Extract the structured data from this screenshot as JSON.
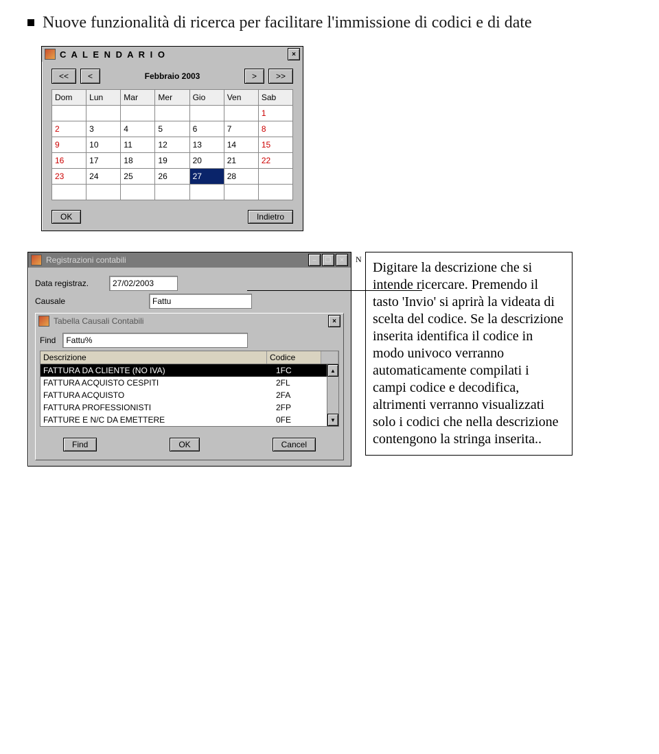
{
  "heading": "Nuove funzionalità di ricerca per facilitare l'immissione di codici e di date",
  "calendar": {
    "title": "C A L E N D A R I O",
    "close_glyph": "×",
    "nav": {
      "first": "<<",
      "prev": "<",
      "month": "Febbraio 2003",
      "next": ">",
      "last": ">>"
    },
    "headers": [
      "Dom",
      "Lun",
      "Mar",
      "Mer",
      "Gio",
      "Ven",
      "Sab"
    ],
    "rows": [
      [
        "",
        "",
        "",
        "",
        "",
        "",
        "1"
      ],
      [
        "2",
        "3",
        "4",
        "5",
        "6",
        "7",
        "8"
      ],
      [
        "9",
        "10",
        "11",
        "12",
        "13",
        "14",
        "15"
      ],
      [
        "16",
        "17",
        "18",
        "19",
        "20",
        "21",
        "22"
      ],
      [
        "23",
        "24",
        "25",
        "26",
        "27",
        "28",
        ""
      ],
      [
        "",
        "",
        "",
        "",
        "",
        "",
        ""
      ]
    ],
    "selected": "27",
    "ok_label": "OK",
    "back_label": "Indietro"
  },
  "reg": {
    "title": "Registrazioni contabili",
    "min_glyph": "–",
    "max_glyph": "❐",
    "close_glyph": "×",
    "n_label": "N",
    "fields": {
      "date_label": "Data registraz.",
      "date_value": "27/02/2003",
      "causale_label": "Causale",
      "causale_value": "Fattu"
    }
  },
  "tabella": {
    "title": "Tabella Causali Contabili",
    "close_glyph": "×",
    "find_label": "Find",
    "find_value": "Fattu%",
    "hdr_desc": "Descrizione",
    "hdr_cod": "Codice",
    "rows": [
      {
        "desc": "FATTURA DA CLIENTE (NO IVA)",
        "cod": "1FC"
      },
      {
        "desc": "FATTURA ACQUISTO CESPITI",
        "cod": "2FL"
      },
      {
        "desc": "FATTURA ACQUISTO",
        "cod": "2FA"
      },
      {
        "desc": "FATTURA PROFESSIONISTI",
        "cod": "2FP"
      },
      {
        "desc": "FATTURE E N/C DA EMETTERE",
        "cod": "0FE"
      }
    ],
    "scroll_up": "▲",
    "scroll_down": "▼",
    "btn_find": "Find",
    "btn_ok": "OK",
    "btn_cancel": "Cancel"
  },
  "callout": {
    "text": "Digitare la descrizione che si intende ricercare. Premendo il tasto 'Invio' si aprirà la videata di scelta del codice. Se la descrizione inserita identifica il codice in modo univoco verranno automaticamente compilati i campi codice e decodifica, altrimenti verranno visualizzati solo i codici che nella descrizione contengono la stringa inserita.."
  }
}
